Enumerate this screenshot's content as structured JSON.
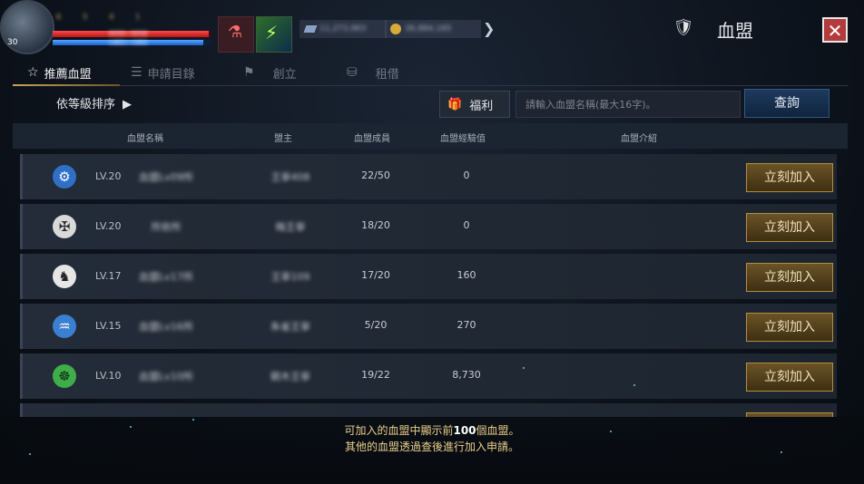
{
  "topbar": {
    "avatar_level": "30",
    "stats": [
      "6",
      "5",
      "4",
      "1"
    ],
    "hp_text": "6058 / 6058",
    "mp_text": "1463 / 1463",
    "hp_fill": 0.98,
    "mp_fill": 0.95,
    "currency_silver": "11,273,963",
    "currency_gold": "36,884,165"
  },
  "header": {
    "title": "血盟"
  },
  "tabs": [
    {
      "label": "推薦血盟",
      "icon": "star-icon",
      "active": true
    },
    {
      "label": "申請目錄",
      "icon": "list-check-icon",
      "active": false
    },
    {
      "label": "創立",
      "icon": "flag-icon",
      "active": false
    },
    {
      "label": "租借",
      "icon": "coins-icon",
      "active": false
    }
  ],
  "toolbar": {
    "sort_label": "依等級排序",
    "benefit_label": "福利",
    "search_placeholder": "請輸入血盟名稱(最大16字)。",
    "query_label": "查詢"
  },
  "table": {
    "headers": [
      "血盟名稱",
      "盟主",
      "血盟成員",
      "血盟經驗值",
      "血盟介紹"
    ],
    "join_label": "立刻加入",
    "rows": [
      {
        "level": "LV.20",
        "name": "血盟Lv09所",
        "leader": "王寧408",
        "members": "22/50",
        "exp": "0",
        "emblem": "cog-emblem-icon",
        "color": "#2f6fc8"
      },
      {
        "level": "LV.20",
        "name": "所依所",
        "leader": "梅王寧",
        "members": "18/20",
        "exp": "0",
        "emblem": "cross-emblem-icon",
        "color": "#d9d9d9"
      },
      {
        "level": "LV.17",
        "name": "血盟Lv17所",
        "leader": "王寧109",
        "members": "17/20",
        "exp": "160",
        "emblem": "unicorn-emblem-icon",
        "color": "#e6e6e6"
      },
      {
        "level": "LV.15",
        "name": "血盟Lv16所",
        "leader": "朱雀王寧",
        "members": "5/20",
        "exp": "270",
        "emblem": "wave-emblem-icon",
        "color": "#3a7fd0"
      },
      {
        "level": "LV.10",
        "name": "血盟Lv10所",
        "leader": "朝木王寧",
        "members": "19/22",
        "exp": "8,730",
        "emblem": "lion-emblem-icon",
        "color": "#3fae4a"
      }
    ]
  },
  "footer": {
    "line1_a": "可加入的血盟中顯示前",
    "line1_b": "100",
    "line1_c": "個血盟。",
    "line2": "其他的血盟透過查後進行加入申請。"
  }
}
